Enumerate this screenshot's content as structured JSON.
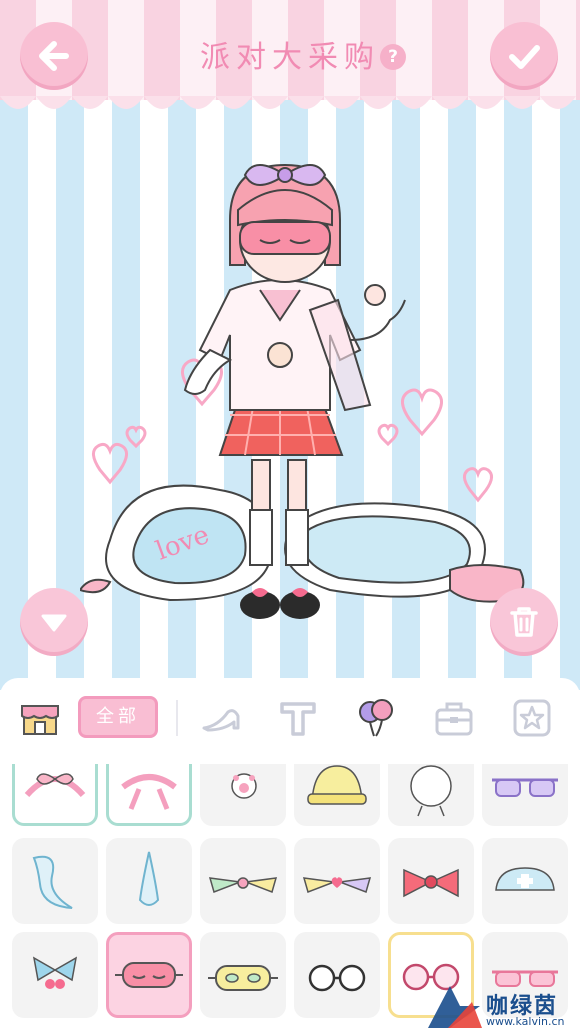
{
  "header": {
    "title": "派对大采购",
    "help_label": "?"
  },
  "buttons": {
    "back": "arrow-left-icon",
    "confirm": "checkmark-icon",
    "collapse": "triangle-down-icon",
    "delete": "trash-icon"
  },
  "categories": {
    "shop": "shop-icon",
    "all_label": "全部",
    "items": [
      "high-heel-shoe-icon",
      "t-shirt-icon",
      "balloon-icon",
      "bag-icon",
      "star-icon"
    ],
    "selected": "全部"
  },
  "grid": {
    "rows": [
      [
        "pink-bow-headband",
        "pink-ribbon-headband",
        "paw-hair-clip",
        "yellow-knit-hat",
        "lace-bonnet",
        "purple-sunglasses"
      ],
      [
        "blue-ghost-tail",
        "blue-drop-accessory",
        "green-ribbon-bow",
        "heart-ribbon-bow",
        "red-bow",
        "nurse-cap"
      ],
      [
        "blue-cherry-bow",
        "pink-sleep-mask",
        "yellow-sleep-mask",
        "round-glasses",
        "pink-round-glasses",
        "pink-sunglasses"
      ]
    ],
    "owned": [
      "pink-bow-headband",
      "pink-ribbon-headband"
    ],
    "selected": [
      "pink-sleep-mask",
      "pink-round-glasses"
    ]
  },
  "watermark": {
    "name": "咖绿茵",
    "url": "www.kalvin.cn"
  },
  "colors": {
    "accent_pink": "#f9bfd3",
    "stripe_blue": "#cfe9f7",
    "title_pink": "#f18bb3",
    "owned_border": "#a9ddd1",
    "selected_yellow": "#f7df8f"
  }
}
